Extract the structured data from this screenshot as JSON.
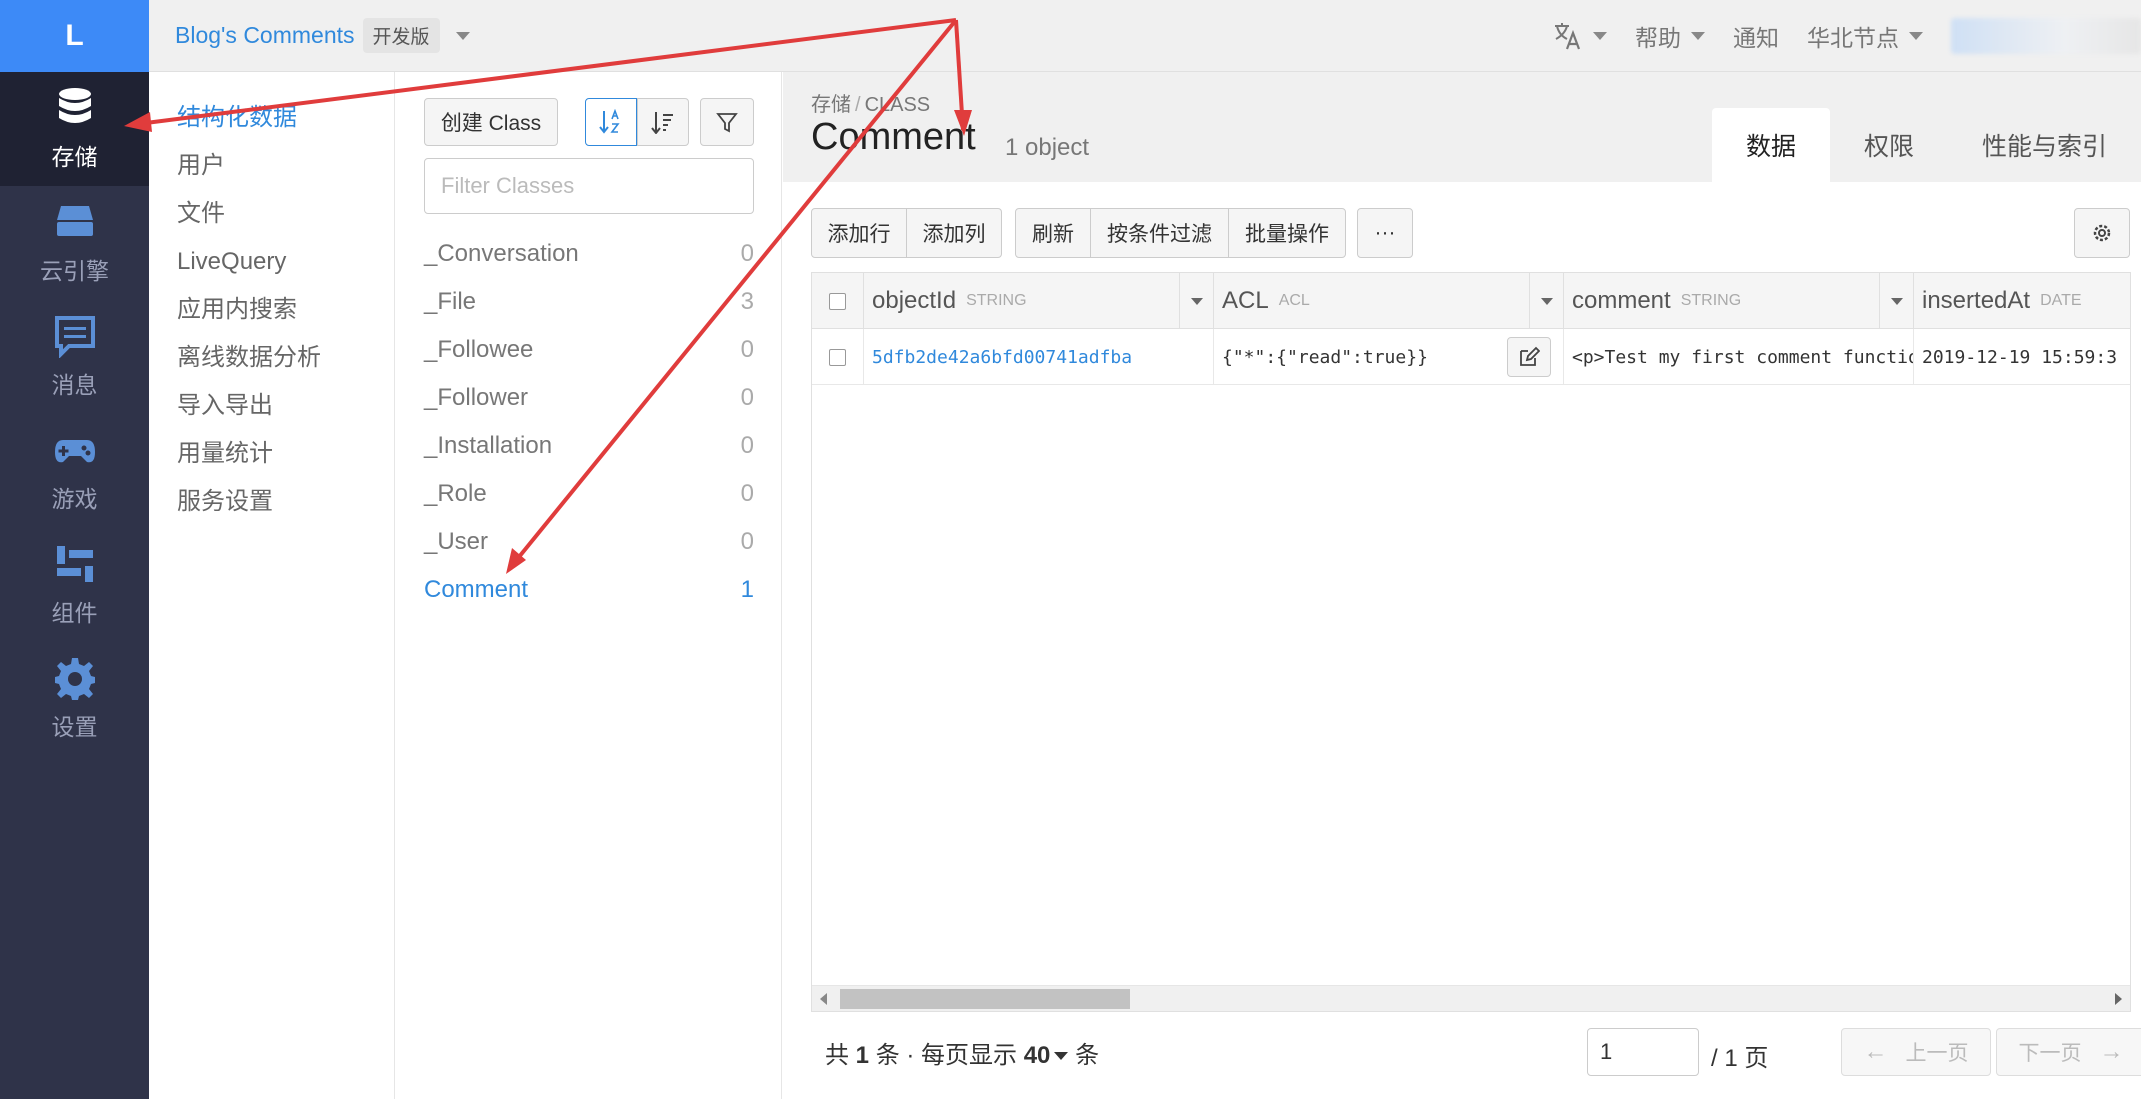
{
  "brand": {
    "logo_letter": "L"
  },
  "leftnav": {
    "items": [
      {
        "label": "存储",
        "icon": "database-icon",
        "active": true
      },
      {
        "label": "云引擎",
        "icon": "engine-icon"
      },
      {
        "label": "消息",
        "icon": "message-icon"
      },
      {
        "label": "游戏",
        "icon": "gamepad-icon"
      },
      {
        "label": "组件",
        "icon": "components-icon"
      },
      {
        "label": "设置",
        "icon": "gear-icon"
      }
    ]
  },
  "topbar": {
    "app_name": "Blog's Comments",
    "env_badge": "开发版",
    "language_icon": "translate-icon",
    "help": "帮助",
    "notify": "通知",
    "region": "华北节点"
  },
  "subnav": {
    "items": [
      "结构化数据",
      "用户",
      "文件",
      "LiveQuery",
      "应用内搜索",
      "离线数据分析",
      "导入导出",
      "用量统计",
      "服务设置"
    ],
    "active_index": 0
  },
  "classes": {
    "create_label": "创建 Class",
    "filter_placeholder": "Filter Classes",
    "list": [
      {
        "name": "_Conversation",
        "count": "0"
      },
      {
        "name": "_File",
        "count": "3"
      },
      {
        "name": "_Followee",
        "count": "0"
      },
      {
        "name": "_Follower",
        "count": "0"
      },
      {
        "name": "_Installation",
        "count": "0"
      },
      {
        "name": "_Role",
        "count": "0"
      },
      {
        "name": "_User",
        "count": "0"
      },
      {
        "name": "Comment",
        "count": "1"
      }
    ]
  },
  "main": {
    "crumb_root": "存储",
    "crumb_sep": "/",
    "crumb_leaf": "CLASS",
    "title": "Comment",
    "object_count": "1 object",
    "tabs": [
      "数据",
      "权限",
      "性能与索引"
    ],
    "toolbar": {
      "add_row": "添加行",
      "add_col": "添加列",
      "refresh": "刷新",
      "filter": "按条件过滤",
      "batch": "批量操作",
      "more": "···"
    },
    "columns": [
      {
        "name": "objectId",
        "type": "STRING"
      },
      {
        "name": "ACL",
        "type": "ACL"
      },
      {
        "name": "comment",
        "type": "STRING"
      },
      {
        "name": "insertedAt",
        "type": "DATE"
      }
    ],
    "rows": [
      {
        "objectId": "5dfb2de42a6bfd00741adfba",
        "ACL": "{\"*\":{\"read\":true}}",
        "comment": "<p>Test my first comment function</p>",
        "insertedAt": "2019-12-19 15:59:3"
      }
    ],
    "pager": {
      "prefix": "共",
      "total": "1",
      "mid": "条 · 每页显示",
      "per_page": "40",
      "suffix": "条",
      "current_page": "1",
      "page_total": "/ 1 页",
      "prev": "上一页",
      "next": "下一页"
    }
  }
}
